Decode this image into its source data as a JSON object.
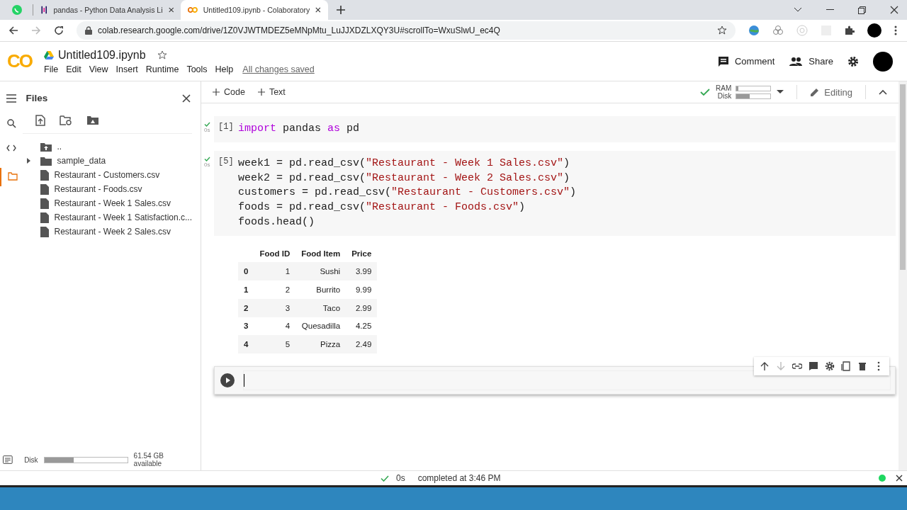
{
  "browser": {
    "tabs": [
      {
        "kind": "chat",
        "selected": false
      },
      {
        "kind": "pandas",
        "title": "pandas - Python Data Analysis Li",
        "selected": false
      },
      {
        "kind": "colab",
        "title": "Untitled109.ipynb - Colaboratory",
        "selected": true
      }
    ],
    "address": "colab.research.google.com/drive/1Z0VJWTMDEZ5eMNpMtu_LuJJXDZLXQY3U#scrollTo=WxuSlwU_ec4Q"
  },
  "notebook": {
    "logo": "CO",
    "title": "Untitled109.ipynb",
    "menu": [
      "File",
      "Edit",
      "View",
      "Insert",
      "Runtime",
      "Tools",
      "Help"
    ],
    "save_status": "All changes saved",
    "actions": [
      {
        "kind": "comment",
        "label": "Comment"
      },
      {
        "kind": "share",
        "label": "Share"
      }
    ]
  },
  "toolbar": {
    "add": [
      "Code",
      "Text"
    ],
    "resources": [
      {
        "label": "RAM",
        "level": 0.05
      },
      {
        "label": "Disk",
        "level": 0.4
      }
    ],
    "mode": "Editing"
  },
  "sidebar": {
    "title": "Files",
    "files": [
      {
        "kind": "up",
        "name": ".."
      },
      {
        "kind": "folder",
        "name": "sample_data",
        "expanded": false
      },
      {
        "kind": "file",
        "name": "Restaurant - Customers.csv"
      },
      {
        "kind": "file",
        "name": "Restaurant - Foods.csv"
      },
      {
        "kind": "file",
        "name": "Restaurant - Week 1 Sales.csv"
      },
      {
        "kind": "file",
        "name": "Restaurant - Week 1 Satisfaction.c..."
      },
      {
        "kind": "file",
        "name": "Restaurant - Week 2 Sales.csv"
      }
    ],
    "disk": {
      "label": "Disk",
      "level": 0.35,
      "text": "61.54 GB available"
    }
  },
  "cells": [
    {
      "count": "[1]",
      "time": "0s",
      "lines": [
        [
          {
            "kind": "kw",
            "text": "import"
          },
          {
            "kind": "plain",
            "text": " pandas "
          },
          {
            "kind": "kw",
            "text": "as"
          },
          {
            "kind": "plain",
            "text": " pd"
          }
        ]
      ]
    },
    {
      "count": "[5]",
      "time": "0s",
      "lines": [
        [
          {
            "kind": "plain",
            "text": "week1 = pd.read_csv("
          },
          {
            "kind": "str",
            "text": "\"Restaurant - Week 1 Sales.csv\""
          },
          {
            "kind": "plain",
            "text": ")"
          }
        ],
        [
          {
            "kind": "plain",
            "text": "week2 = pd.read_csv("
          },
          {
            "kind": "str",
            "text": "\"Restaurant - Week 2 Sales.csv\""
          },
          {
            "kind": "plain",
            "text": ")"
          }
        ],
        [
          {
            "kind": "plain",
            "text": "customers = pd.read_csv("
          },
          {
            "kind": "str",
            "text": "\"Restaurant - Customers.csv\""
          },
          {
            "kind": "plain",
            "text": ")"
          }
        ],
        [
          {
            "kind": "plain",
            "text": "foods = pd.read_csv("
          },
          {
            "kind": "str",
            "text": "\"Restaurant - Foods.csv\""
          },
          {
            "kind": "plain",
            "text": ")"
          }
        ],
        [
          {
            "kind": "plain",
            "text": "foods.head()"
          }
        ]
      ],
      "output": {
        "columns": [
          "Food ID",
          "Food Item",
          "Price"
        ],
        "rows": [
          {
            "index": "0",
            "cells": [
              "1",
              "Sushi",
              "3.99"
            ]
          },
          {
            "index": "1",
            "cells": [
              "2",
              "Burrito",
              "9.99"
            ]
          },
          {
            "index": "2",
            "cells": [
              "3",
              "Taco",
              "2.99"
            ]
          },
          {
            "index": "3",
            "cells": [
              "4",
              "Quesadilla",
              "4.25"
            ]
          },
          {
            "index": "4",
            "cells": [
              "5",
              "Pizza",
              "2.49"
            ]
          }
        ]
      }
    }
  ],
  "status": {
    "time": "0s",
    "text": "completed at 3:46 PM"
  }
}
